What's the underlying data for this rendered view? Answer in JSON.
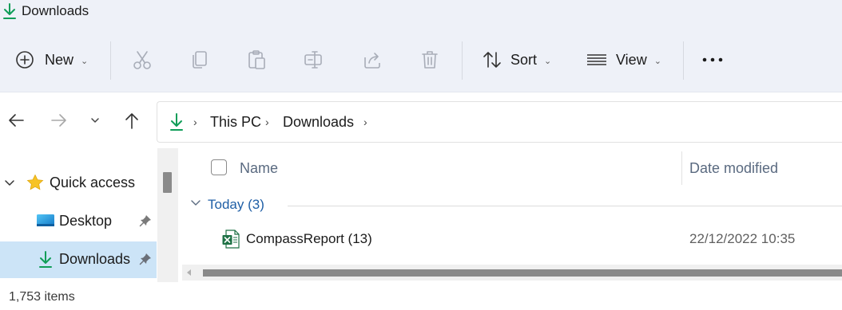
{
  "window": {
    "title": "Downloads",
    "icon": "download-arrow-icon",
    "accent": "#0f9d58"
  },
  "toolbar": {
    "new_label": "New",
    "sort_label": "Sort",
    "view_label": "View",
    "icons": [
      "plus-circle-icon",
      "cut-icon",
      "copy-icon",
      "paste-icon",
      "rename-icon",
      "share-icon",
      "delete-icon",
      "sort-icon",
      "view-lines-icon",
      "more-icon"
    ]
  },
  "nav": {
    "breadcrumb": [
      "This PC",
      "Downloads"
    ]
  },
  "sidebar": {
    "items": [
      {
        "label": "Quick access",
        "icon": "star-icon"
      },
      {
        "label": "Desktop",
        "icon": "desktop-icon",
        "pinned": true
      },
      {
        "label": "Downloads",
        "icon": "download-arrow-icon",
        "pinned": true,
        "selected": true
      }
    ]
  },
  "content": {
    "columns": [
      "Name",
      "Date modified"
    ],
    "group": {
      "label": "Today (3)"
    },
    "rows": [
      {
        "name": "CompassReport (13)",
        "date": "22/12/2022 10:35",
        "icon": "excel-icon"
      }
    ]
  },
  "status": {
    "item_count": "1,753 items"
  },
  "colors": {
    "toolbar_bg": "#eef1f8",
    "selected_bg": "#cce4f7",
    "group_text": "#1f5fa6",
    "excel_green": "#1e7145"
  }
}
